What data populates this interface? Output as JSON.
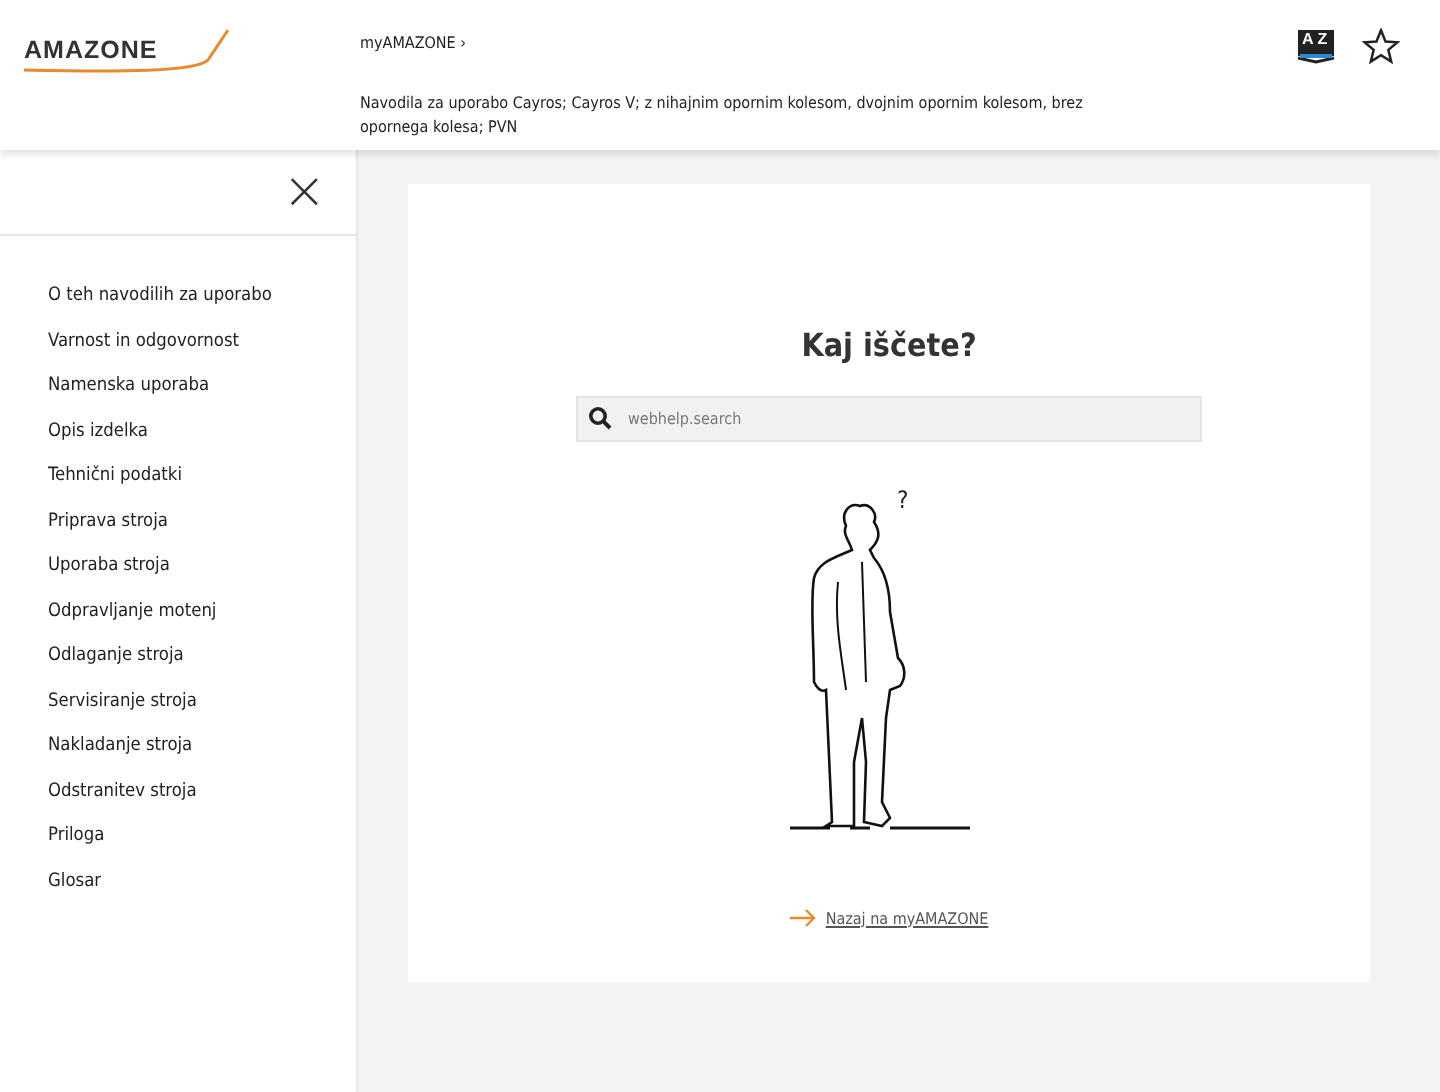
{
  "header": {
    "logo": "AMAZONE",
    "breadcrumb": "myAMAZONE",
    "breadcrumb_sep": "›",
    "document_title": "Navodila za uporabo Cayros; Cayros V; z nihajnim opornim kolesom, dvojnim opornim kolesom, brez opornega kolesa; PVN",
    "glossary_letters": [
      "A",
      "Z"
    ]
  },
  "sidebar": {
    "close": "×",
    "items": [
      {
        "label": "O teh navodilih za uporabo"
      },
      {
        "label": "Varnost in odgovornost"
      },
      {
        "label": "Namenska uporaba"
      },
      {
        "label": "Opis izdelka"
      },
      {
        "label": "Tehnični podatki"
      },
      {
        "label": "Priprava stroja"
      },
      {
        "label": "Uporaba stroja"
      },
      {
        "label": "Odpravljanje motenj"
      },
      {
        "label": "Odlaganje stroja"
      },
      {
        "label": "Servisiranje stroja"
      },
      {
        "label": "Nakladanje stroja"
      },
      {
        "label": "Odstranitev stroja"
      },
      {
        "label": "Priloga"
      },
      {
        "label": "Glosar"
      }
    ]
  },
  "main": {
    "heading": "Kaj iščete?",
    "search": {
      "placeholder": "webhelp.search"
    },
    "figure_mark": "?",
    "back_link": "Nazaj na myAMAZONE"
  }
}
